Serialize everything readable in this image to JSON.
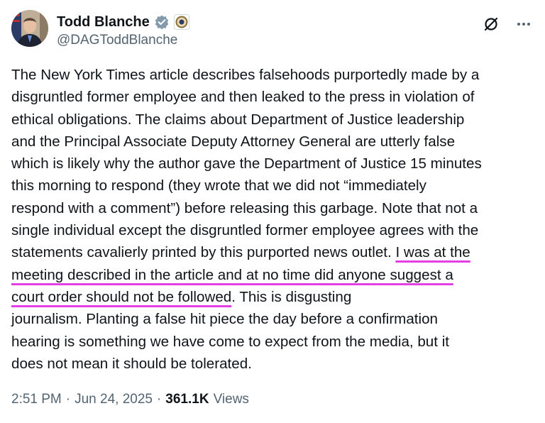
{
  "author": {
    "display_name": "Todd Blanche",
    "handle": "@DAGToddBlanche"
  },
  "icons": {
    "verified": "verified-badge-icon",
    "affiliation": "doj-seal-icon",
    "grok": "slash-circle-icon",
    "more": "more-dots-icon"
  },
  "colors": {
    "text": "#0f1419",
    "muted": "#536471",
    "highlight": "#e43ee4"
  },
  "tweet": {
    "text_before": "The New York Times article describes falsehoods purportedly made by a\ndisgruntled former employee and then leaked to the press in violation of\nethical obligations. The claims about Department of Justice leadership\nand the Principal Associate Deputy Attorney General are utterly false\nwhich is likely why the author gave the Department of Justice 15 minutes\nthis morning to respond (they wrote that we did not “immediately\nrespond with a comment”) before releasing this garbage. Note that not a\nsingle individual except the disgruntled former employee agrees with the\nstatements cavalierly printed by this purported news outlet. ",
    "text_highlighted": "I was at the\nmeeting described in the article and at no time did anyone suggest a\ncourt order should not be followed",
    "text_after": ". This is disgusting\njournalism. Planting a false hit piece the day before a confirmation\nhearing is something we have come to expect from the media, but it\ndoes not mean it should be tolerated."
  },
  "meta": {
    "time": "2:51 PM",
    "date": "Jun 24, 2025",
    "separator": "·",
    "views_count": "361.1K",
    "views_label": "Views"
  }
}
